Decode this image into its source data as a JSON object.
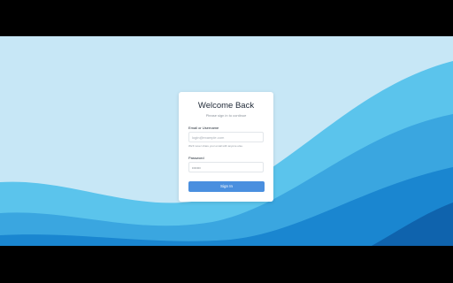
{
  "theme": {
    "background": "#c7e7f6",
    "wave_colors": [
      "#5bc4ec",
      "#3aa6e0",
      "#1a86d0",
      "#0f63ad"
    ],
    "accent": "#4a8fdf"
  },
  "login": {
    "title": "Welcome Back",
    "subtitle": "Please sign in to continue",
    "email_label": "Email or Username",
    "email_placeholder": "login@example.com",
    "email_help": "We'll never share your email with anyone else.",
    "password_label": "Password",
    "password_value": "•••••••",
    "submit_label": "Sign In"
  }
}
